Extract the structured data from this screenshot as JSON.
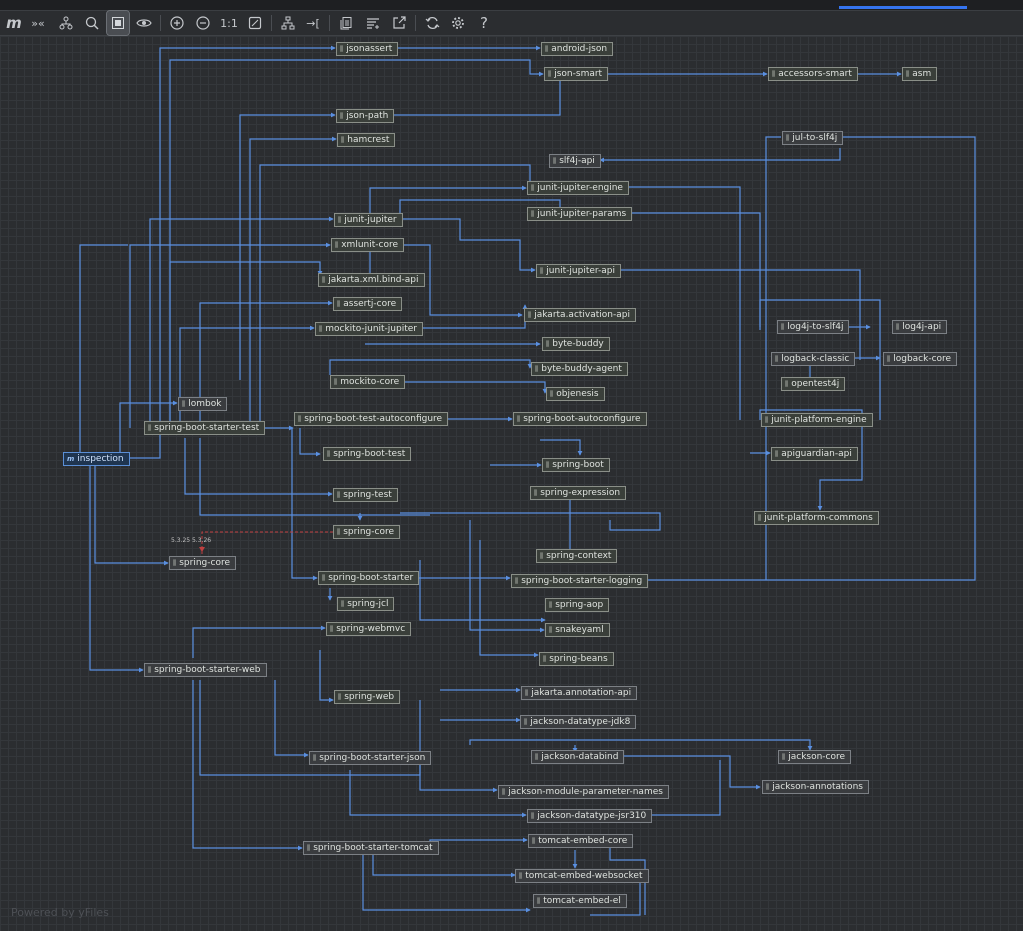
{
  "toolbar": {
    "items": [
      {
        "name": "maven-logo-icon",
        "glyph": "m"
      },
      {
        "name": "show-paths-icon",
        "glyph": "»«"
      },
      {
        "name": "hierarchy-icon",
        "glyph": "⋔"
      },
      {
        "name": "find-icon",
        "glyph": "◎"
      },
      {
        "name": "select-mode-icon",
        "glyph": "▦"
      },
      {
        "name": "eye-icon",
        "glyph": "◉"
      },
      {
        "name": "zoom-in-icon",
        "glyph": "⊕"
      },
      {
        "name": "zoom-out-icon",
        "glyph": "⊖"
      },
      {
        "name": "actual-size-icon",
        "glyph": "1:1"
      },
      {
        "name": "fit-content-icon",
        "glyph": "⊡"
      },
      {
        "name": "layout-icon",
        "glyph": "⊤"
      },
      {
        "name": "apply-layout-icon",
        "glyph": "→["
      },
      {
        "name": "copy-icon",
        "glyph": "❐"
      },
      {
        "name": "filter-icon",
        "glyph": "≡"
      },
      {
        "name": "export-icon",
        "glyph": "↗"
      },
      {
        "name": "refresh-icon",
        "glyph": "⟳"
      },
      {
        "name": "settings-icon",
        "glyph": "⚙"
      },
      {
        "name": "help-icon",
        "glyph": "?"
      }
    ]
  },
  "nodes": {
    "jsonassert": "jsonassert",
    "android_json": "android-json",
    "json_smart": "json-smart",
    "accessors_smart": "accessors-smart",
    "asm": "asm",
    "json_path": "json-path",
    "hamcrest": "hamcrest",
    "jul_to_slf4j": "jul-to-slf4j",
    "slf4j_api": "slf4j-api",
    "junit_jupiter_engine": "junit-jupiter-engine",
    "junit_jupiter_params": "junit-jupiter-params",
    "junit_jupiter": "junit-jupiter",
    "xmlunit_core": "xmlunit-core",
    "junit_jupiter_api": "junit-jupiter-api",
    "jakarta_xml_bind_api": "jakarta.xml.bind-api",
    "assertj_core": "assertj-core",
    "jakarta_activation_api": "jakarta.activation-api",
    "mockito_junit_jupiter": "mockito-junit-jupiter",
    "log4j_to_slf4j": "log4j-to-slf4j",
    "log4j_api": "log4j-api",
    "byte_buddy": "byte-buddy",
    "logback_classic": "logback-classic",
    "logback_core": "logback-core",
    "byte_buddy_agent": "byte-buddy-agent",
    "mockito_core": "mockito-core",
    "opentest4j": "opentest4j",
    "objenesis": "objenesis",
    "lombok": "lombok",
    "spring_boot_test_autoconfigure": "spring-boot-test-autoconfigure",
    "spring_boot_autoconfigure": "spring-boot-autoconfigure",
    "junit_platform_engine": "junit-platform-engine",
    "spring_boot_starter_test": "spring-boot-starter-test",
    "inspection": "inspection",
    "spring_boot_test": "spring-boot-test",
    "apiguardian_api": "apiguardian-api",
    "spring_boot": "spring-boot",
    "spring_expression": "spring-expression",
    "spring_test": "spring-test",
    "junit_platform_commons": "junit-platform-commons",
    "spring_core_top": "spring-core",
    "spring_context": "spring-context",
    "spring_core_conflict": "spring-core",
    "spring_boot_starter": "spring-boot-starter",
    "spring_boot_starter_logging": "spring-boot-starter-logging",
    "spring_jcl": "spring-jcl",
    "spring_aop": "spring-aop",
    "spring_webmvc": "spring-webmvc",
    "snakeyaml": "snakeyaml",
    "spring_beans": "spring-beans",
    "spring_boot_starter_web": "spring-boot-starter-web",
    "spring_web": "spring-web",
    "jakarta_annotation_api": "jakarta.annotation-api",
    "jackson_datatype_jdk8": "jackson-datatype-jdk8",
    "jackson_databind": "jackson-databind",
    "jackson_core": "jackson-core",
    "spring_boot_starter_json": "spring-boot-starter-json",
    "jackson_annotations": "jackson-annotations",
    "jackson_module_parameter_names": "jackson-module-parameter-names",
    "jackson_datatype_jsr310": "jackson-datatype-jsr310",
    "tomcat_embed_core": "tomcat-embed-core",
    "spring_boot_starter_tomcat": "spring-boot-starter-tomcat",
    "tomcat_embed_websocket": "tomcat-embed-websocket",
    "tomcat_embed_el": "tomcat-embed-el"
  },
  "conflict_label": "5.3.25 5.3.26",
  "watermark": "Powered by yFiles",
  "colors": {
    "edge": "#5a8fe0",
    "conflict_edge": "#c04040",
    "node_border": "#8a8f88"
  }
}
